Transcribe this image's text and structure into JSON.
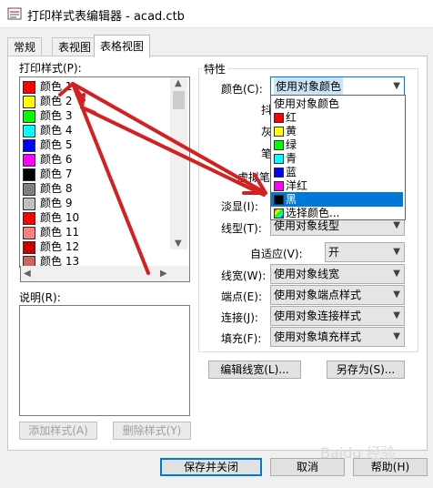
{
  "window": {
    "title": "打印样式表编辑器 - acad.ctb"
  },
  "tabs": [
    {
      "label": "常规",
      "active": false
    },
    {
      "label": "表视图",
      "active": false
    },
    {
      "label": "表格视图",
      "active": true
    }
  ],
  "print_styles": {
    "label": "打印样式(P):",
    "items": [
      {
        "label": "颜色 1",
        "color": "#ff0000"
      },
      {
        "label": "颜色 2",
        "color": "#ffff00"
      },
      {
        "label": "颜色 3",
        "color": "#00ff00"
      },
      {
        "label": "颜色 4",
        "color": "#00ffff"
      },
      {
        "label": "颜色 5",
        "color": "#0000ff"
      },
      {
        "label": "颜色 6",
        "color": "#ff00ff"
      },
      {
        "label": "颜色 7",
        "color": "#000000"
      },
      {
        "label": "颜色 8",
        "color": "#808080"
      },
      {
        "label": "颜色 9",
        "color": "#c0c0c0"
      },
      {
        "label": "颜色 10",
        "color": "#ff0000"
      },
      {
        "label": "颜色 11",
        "color": "#ff7f7f"
      },
      {
        "label": "颜色 12",
        "color": "#cc0000"
      },
      {
        "label": "颜色 13",
        "color": "#cc6666"
      }
    ]
  },
  "description": {
    "label": "说明(R):",
    "value": ""
  },
  "buttons": {
    "add_style": "添加样式(A)",
    "delete_style": "删除样式(Y)",
    "edit_lineweight": "编辑线宽(L)...",
    "save_as": "另存为(S)...",
    "save_close": "保存并关闭",
    "cancel": "取消",
    "help": "帮助(H)"
  },
  "properties": {
    "title": "特性",
    "color_label": "颜色(C):",
    "color_value": "使用对象颜色",
    "color_options": [
      {
        "label": "使用对象颜色",
        "swatch": ""
      },
      {
        "label": "红",
        "swatch": "#ff0000"
      },
      {
        "label": "黄",
        "swatch": "#ffff00"
      },
      {
        "label": "绿",
        "swatch": "#00ff00"
      },
      {
        "label": "青",
        "swatch": "#00ffff"
      },
      {
        "label": "蓝",
        "swatch": "#0000ff"
      },
      {
        "label": "洋红",
        "swatch": "#ff00ff"
      },
      {
        "label": "黑",
        "swatch": "#000000"
      },
      {
        "label": "选择颜色...",
        "swatch": "rainbow"
      }
    ],
    "selected_option_index": 7,
    "partial_labels": {
      "dither": "抖",
      "grayscale": "灰",
      "pen": "笔",
      "virtual_pen": "虚拟笔",
      "screening": "淡显(I):"
    },
    "linetype_label": "线型(T):",
    "linetype_value": "使用对象线型",
    "adaptive_label": "自适应(V):",
    "adaptive_value": "开",
    "lineweight_label": "线宽(W):",
    "lineweight_value": "使用对象线宽",
    "endpoint_label": "端点(E):",
    "endpoint_value": "使用对象端点样式",
    "join_label": "连接(J):",
    "join_value": "使用对象连接样式",
    "fill_label": "填充(F):",
    "fill_value": "使用对象填充样式"
  },
  "annotation_color": "#d42020",
  "watermark": "Baidu 经验"
}
